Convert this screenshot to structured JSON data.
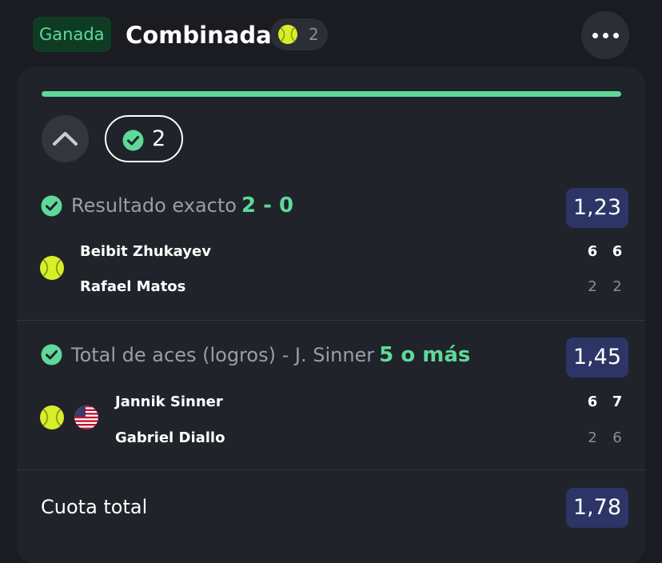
{
  "header": {
    "status": "Ganada",
    "title": "Combinada",
    "selection_count": "2",
    "more_icon": "more-horizontal-icon"
  },
  "summary": {
    "progress_fraction": 1.0,
    "won_count": "2"
  },
  "bets": [
    {
      "market": "Resultado exacto",
      "selection": "2 - 0",
      "odds": "1,23",
      "players": [
        {
          "name": "Beibit Zhukayev",
          "scores": [
            "6",
            "6"
          ],
          "winner": true
        },
        {
          "name": "Rafael Matos",
          "scores": [
            "2",
            "2"
          ],
          "winner": false
        }
      ]
    },
    {
      "market": "Total de aces (logros) - J. Sinner",
      "selection": "5 o más",
      "odds": "1,45",
      "players": [
        {
          "name": "Jannik Sinner",
          "scores": [
            "6",
            "7"
          ],
          "winner": true
        },
        {
          "name": "Gabriel Diallo",
          "scores": [
            "2",
            "6"
          ],
          "winner": false
        }
      ]
    }
  ],
  "total": {
    "label": "Cuota total",
    "odds": "1,78"
  },
  "colors": {
    "accent_green": "#5ed99a",
    "odds_badge": "#2c3566",
    "background": "#1a1c22",
    "card": "#202329"
  }
}
